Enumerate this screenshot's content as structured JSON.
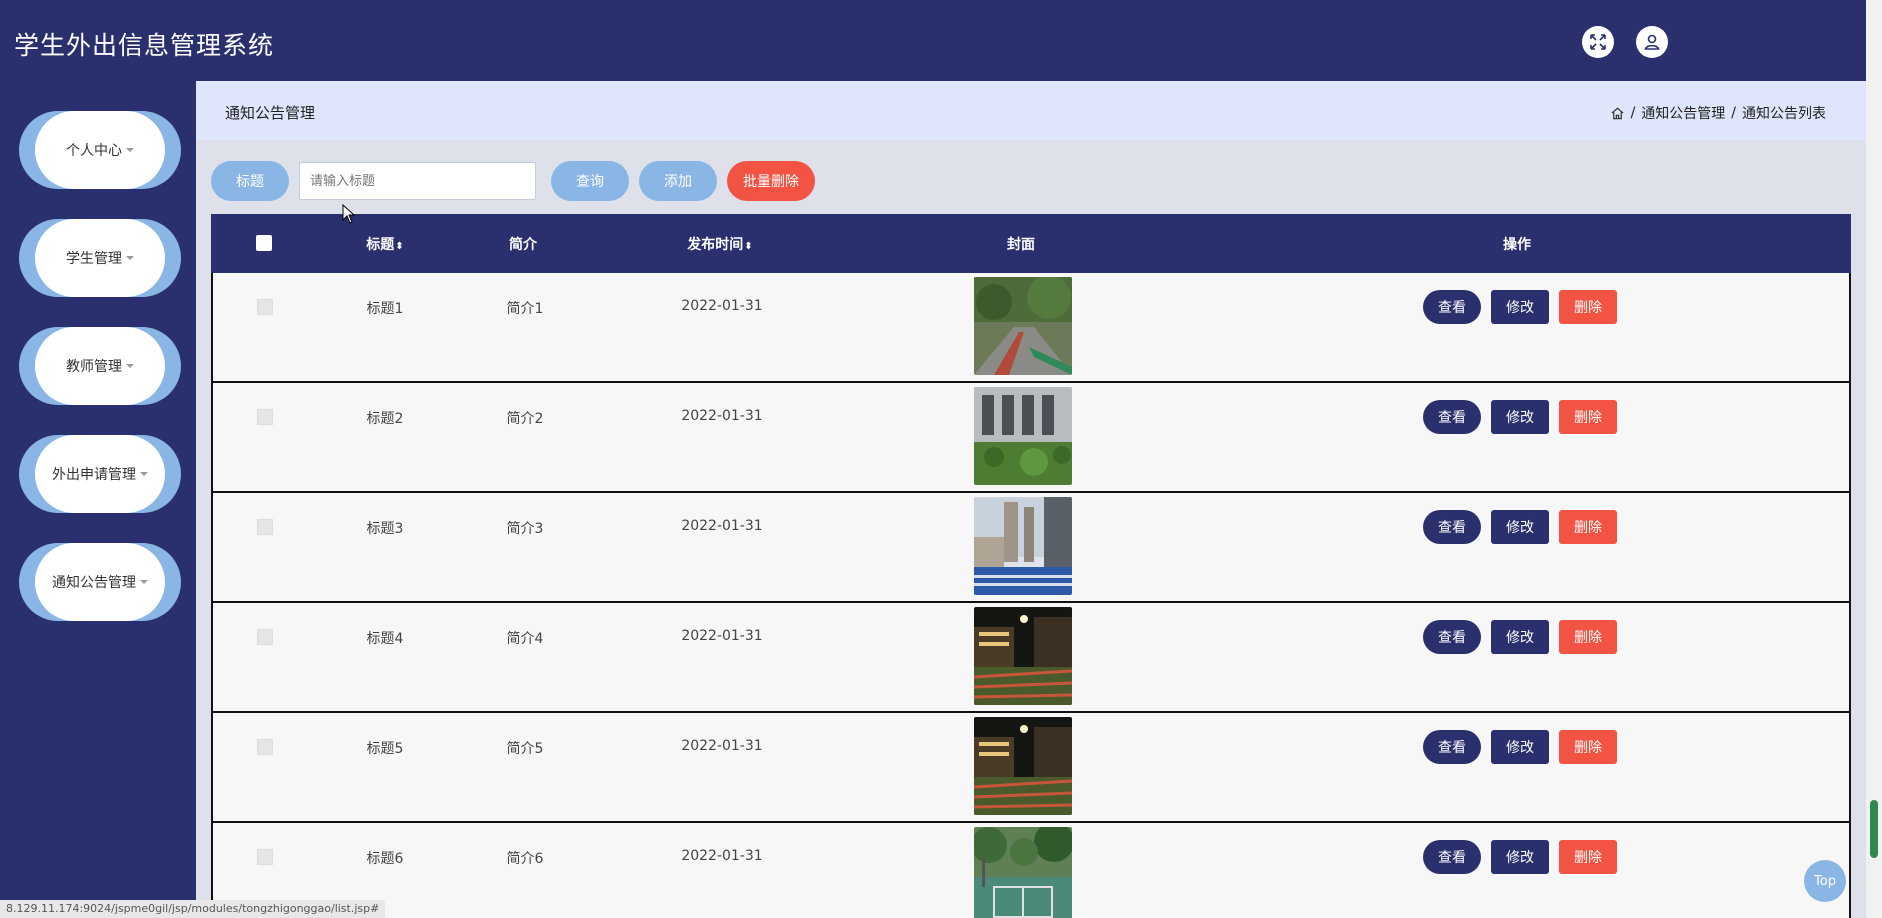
{
  "app": {
    "title": "学生外出信息管理系统"
  },
  "sidebar": {
    "items": [
      {
        "label": "个人中心"
      },
      {
        "label": "学生管理"
      },
      {
        "label": "教师管理"
      },
      {
        "label": "外出申请管理"
      },
      {
        "label": "通知公告管理"
      }
    ]
  },
  "breadcrumb": {
    "page_title": "通知公告管理",
    "path": [
      "通知公告管理",
      "通知公告列表"
    ],
    "sep": "/"
  },
  "search": {
    "label": "标题",
    "placeholder": "请输入标题",
    "query_label": "查询",
    "add_label": "添加",
    "batch_delete_label": "批量删除"
  },
  "table": {
    "headers": {
      "title": "标题",
      "intro": "简介",
      "time": "发布时间",
      "cover": "封面",
      "ops": "操作"
    },
    "sort_glyph": "⬍",
    "rows": [
      {
        "title": "标题1",
        "intro": "简介1",
        "time": "2022-01-31",
        "cover": "campus-path"
      },
      {
        "title": "标题2",
        "intro": "简介2",
        "time": "2022-01-31",
        "cover": "building-garden"
      },
      {
        "title": "标题3",
        "intro": "简介3",
        "time": "2022-01-31",
        "cover": "track-field"
      },
      {
        "title": "标题4",
        "intro": "简介4",
        "time": "2022-01-31",
        "cover": "night-field"
      },
      {
        "title": "标题5",
        "intro": "简介5",
        "time": "2022-01-31",
        "cover": "night-field"
      },
      {
        "title": "标题6",
        "intro": "简介6",
        "time": "2022-01-31",
        "cover": "basketball-court"
      }
    ],
    "op_labels": {
      "view": "查看",
      "edit": "修改",
      "delete": "删除"
    }
  },
  "top_button": {
    "label": "Top"
  },
  "status_url": "8.129.11.174:9024/jspme0gil/jsp/modules/tongzhigonggao/list.jsp#",
  "colors": {
    "primary": "#2a2f6e",
    "accent": "#8ab6e6",
    "danger": "#f25343"
  }
}
